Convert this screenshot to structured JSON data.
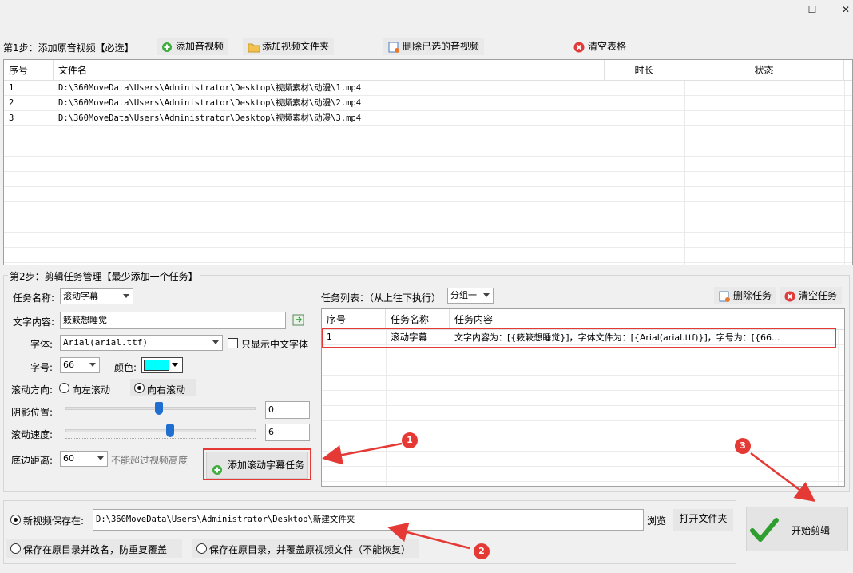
{
  "window": {
    "minimize_glyph": "—",
    "maximize_glyph": "☐",
    "close_glyph": "✕"
  },
  "step1": {
    "title": "第1步：添加原音视频【必选】",
    "add_av": "添加音视频",
    "add_folder": "添加视频文件夹",
    "delete_selected": "删除已选的音视频",
    "clear_table": "清空表格"
  },
  "file_table": {
    "headers": [
      "序号",
      "文件名",
      "时长",
      "状态"
    ],
    "rows": [
      {
        "no": "1",
        "file": "D:\\360MoveData\\Users\\Administrator\\Desktop\\视频素材\\动漫\\1.mp4",
        "duration": "",
        "status": ""
      },
      {
        "no": "2",
        "file": "D:\\360MoveData\\Users\\Administrator\\Desktop\\视频素材\\动漫\\2.mp4",
        "duration": "",
        "status": ""
      },
      {
        "no": "3",
        "file": "D:\\360MoveData\\Users\\Administrator\\Desktop\\视频素材\\动漫\\3.mp4",
        "duration": "",
        "status": ""
      }
    ]
  },
  "step2": {
    "title": "第2步：剪辑任务管理【最少添加一个任务】",
    "task_name_label": "任务名称:",
    "task_name_value": "滚动字幕",
    "text_label": "文字内容:",
    "text_value": "簌簌想睡觉",
    "font_label": "字体:",
    "font_value": "Arial(arial.ttf)",
    "only_chinese_font": "只显示中文字体",
    "size_label": "字号:",
    "size_value": "66",
    "color_label": "颜色:",
    "color_value": "#00ffff",
    "direction_label": "滚动方向:",
    "dir_left": "向左滚动",
    "dir_right": "向右滚动",
    "shadow_label": "阴影位置:",
    "shadow_value": "0",
    "shadow_slider_fraction": 0.49,
    "speed_label": "滚动速度:",
    "speed_value": "6",
    "speed_slider_fraction": 0.55,
    "bottom_label": "底边距离:",
    "bottom_value": "60",
    "bottom_hint": "不能超过视频高度",
    "add_task_button": "添加滚动字幕任务"
  },
  "task_list": {
    "label": "任务列表：（从上往下执行）",
    "group_value": "分组一",
    "delete_task": "删除任务",
    "clear_tasks": "清空任务",
    "headers": [
      "序号",
      "任务名称",
      "任务内容"
    ],
    "rows": [
      {
        "no": "1",
        "name": "滚动字幕",
        "content": "文字内容为：[{簌簌想睡觉}]，字体文件为：[{Arial(arial.ttf)}]，字号为：[{66..."
      }
    ]
  },
  "output": {
    "save_to_label": "新视频保存在:",
    "save_path": "D:\\360MoveData\\Users\\Administrator\\Desktop\\新建文件夹",
    "browse": "浏览",
    "open_folder": "打开文件夹",
    "opt_rename": "保存在原目录并改名，防重复覆盖",
    "opt_overwrite": "保存在原目录，并覆盖原视频文件（不能恢复）",
    "start_button": "开始剪辑"
  },
  "annotations": [
    "1",
    "2",
    "3"
  ],
  "colors": {
    "accent_red": "#e53935",
    "slider_blue": "#1f6fd1",
    "check_green": "#2e9e2e"
  }
}
